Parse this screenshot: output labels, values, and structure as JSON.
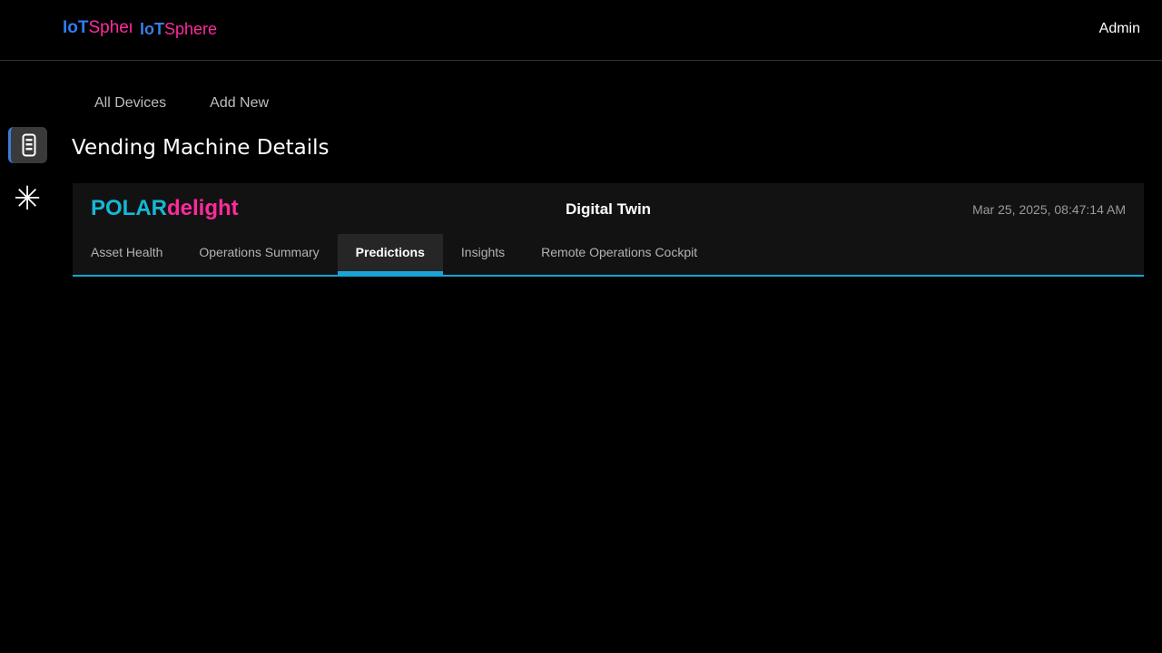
{
  "header": {
    "logo_primary": {
      "iot": "IoT",
      "sphere": "Sphere"
    },
    "logo_secondary": {
      "iot": "IoT",
      "sphere": "Sphere"
    },
    "user_label": "Admin"
  },
  "sidebar": {
    "items": [
      {
        "icon": "device-icon",
        "active": true
      },
      {
        "icon": "asterisk-icon",
        "glyph": "✳",
        "active": false
      }
    ]
  },
  "subnav": {
    "items": [
      {
        "label": "All Devices"
      },
      {
        "label": "Add New"
      }
    ]
  },
  "page": {
    "title": "Vending Machine Details"
  },
  "device_card": {
    "brand_polar": "POLAR",
    "brand_delight": "delight",
    "center_title": "Digital Twin",
    "timestamp": "Mar 25, 2025, 08:47:14 AM",
    "tabs": [
      {
        "label": "Asset Health",
        "active": false
      },
      {
        "label": "Operations Summary",
        "active": false
      },
      {
        "label": "Predictions",
        "active": true
      },
      {
        "label": "Insights",
        "active": false
      },
      {
        "label": "Remote Operations Cockpit",
        "active": false
      }
    ]
  },
  "colors": {
    "accent_blue": "#1aa3d6",
    "brand_cyan": "#15b8d6",
    "brand_pink": "#ff2a9b",
    "background": "#000000",
    "card_background": "#121212"
  }
}
